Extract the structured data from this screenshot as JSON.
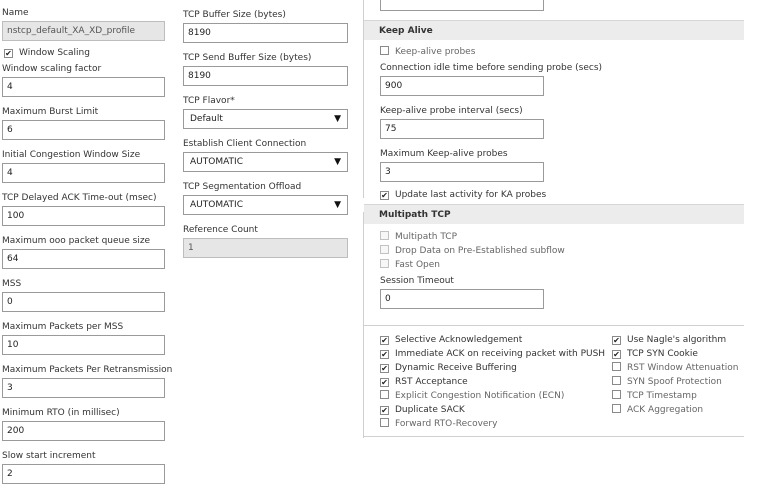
{
  "left": {
    "name_label": "Name",
    "name_value": "nstcp_default_XA_XD_profile",
    "window_scaling": {
      "label": "Window Scaling",
      "checked": true
    },
    "fields": [
      {
        "label": "Window scaling factor",
        "value": "4"
      },
      {
        "label": "Maximum Burst Limit",
        "value": "6"
      },
      {
        "label": "Initial Congestion Window Size",
        "value": "4"
      },
      {
        "label": "TCP Delayed ACK Time-out (msec)",
        "value": "100"
      },
      {
        "label": "Maximum ooo packet queue size",
        "value": "64"
      },
      {
        "label": "MSS",
        "value": "0"
      },
      {
        "label": "Maximum Packets per MSS",
        "value": "10"
      },
      {
        "label": "Maximum Packets Per Retransmission",
        "value": "3"
      },
      {
        "label": "Minimum RTO (in millisec)",
        "value": "200"
      },
      {
        "label": "Slow start increment",
        "value": "2"
      }
    ]
  },
  "middle": {
    "tcp_buffer": {
      "label": "TCP Buffer Size (bytes)",
      "value": "8190"
    },
    "tcp_send_buffer": {
      "label": "TCP Send Buffer Size (bytes)",
      "value": "8190"
    },
    "tcp_flavor": {
      "label": "TCP Flavor*",
      "value": "Default"
    },
    "client_connection": {
      "label": "Establish Client Connection",
      "value": "AUTOMATIC"
    },
    "segmentation_offload": {
      "label": "TCP Segmentation Offload",
      "value": "AUTOMATIC"
    },
    "reference_count": {
      "label": "Reference Count",
      "value": "1"
    },
    "dropdown_arrow": "▼"
  },
  "keep_alive": {
    "title": "Keep Alive",
    "probes": {
      "label": "Keep-alive probes",
      "checked": false
    },
    "idle_time": {
      "label": "Connection idle time before sending probe (secs)",
      "value": "900"
    },
    "interval": {
      "label": "Keep-alive probe interval (secs)",
      "value": "75"
    },
    "max_probes": {
      "label": "Maximum Keep-alive probes",
      "value": "3"
    },
    "update_activity": {
      "label": "Update last activity for KA probes",
      "checked": true
    }
  },
  "multipath": {
    "title": "Multipath TCP",
    "options": [
      {
        "label": "Multipath TCP",
        "checked": false
      },
      {
        "label": "Drop Data on Pre-Established subflow",
        "checked": false
      },
      {
        "label": "Fast Open",
        "checked": false
      }
    ],
    "session_timeout": {
      "label": "Session Timeout",
      "value": "0"
    }
  },
  "options_left": [
    {
      "label": "Selective Acknowledgement",
      "checked": true
    },
    {
      "label": "Immediate ACK on receiving packet with PUSH",
      "checked": true
    },
    {
      "label": "Dynamic Receive Buffering",
      "checked": true
    },
    {
      "label": "RST Acceptance",
      "checked": true
    },
    {
      "label": "Explicit Congestion Notification (ECN)",
      "checked": false
    },
    {
      "label": "Duplicate SACK",
      "checked": true
    },
    {
      "label": "Forward RTO-Recovery",
      "checked": false
    }
  ],
  "options_right": [
    {
      "label": "Use Nagle's algorithm",
      "checked": true
    },
    {
      "label": "TCP SYN Cookie",
      "checked": true
    },
    {
      "label": "RST Window Attenuation",
      "checked": false
    },
    {
      "label": "SYN Spoof Protection",
      "checked": false
    },
    {
      "label": "TCP Timestamp",
      "checked": false
    },
    {
      "label": "ACK Aggregation",
      "checked": false
    }
  ],
  "check_glyph": "✔"
}
